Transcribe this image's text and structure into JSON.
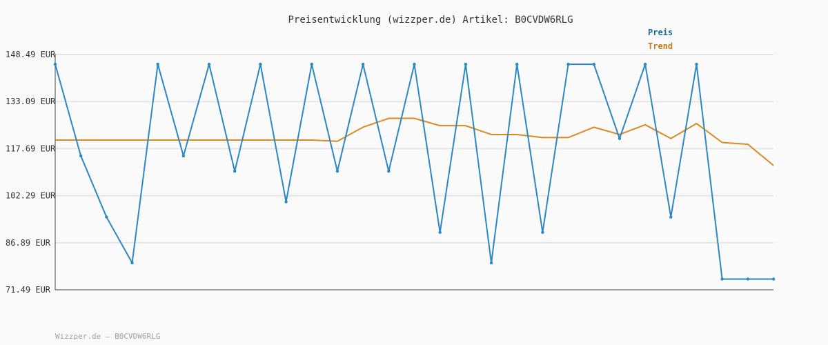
{
  "colors": {
    "background": "#fafafa",
    "grid": "#e6e6e6",
    "axis": "#444444",
    "price": "#2a87c4",
    "trend": "#d88a22",
    "legend_price": "#136f9e",
    "legend_trend": "#c57c18"
  },
  "footer_text": "Wizzper.de – B0CVDW6RLG",
  "chart_data": {
    "type": "line",
    "title": "Preisentwicklung (wizzper.de) Artikel: B0CVDW6RLG",
    "xlabel": "",
    "ylabel": "",
    "ylim": [
      71.49,
      148.49
    ],
    "yticks": [
      148.49,
      133.09,
      117.69,
      102.29,
      86.89,
      71.49
    ],
    "ytick_labels": [
      "148.49 EUR",
      "133.09 EUR",
      "117.69 EUR",
      "102.29 EUR",
      "86.89 EUR",
      "71.49 EUR"
    ],
    "grid": true,
    "legend": "top-right",
    "x": [
      1,
      2,
      3,
      4,
      5,
      6,
      7,
      8,
      9,
      10,
      11,
      12,
      13,
      14,
      15,
      16,
      17,
      18,
      19,
      20,
      21,
      22,
      23,
      24,
      25,
      26,
      27,
      28,
      29
    ],
    "series": [
      {
        "name": "Preis",
        "color": "#2a87c4",
        "markers": true,
        "values": [
          145.3,
          115.3,
          95.3,
          80.3,
          145.3,
          115.3,
          145.3,
          110.3,
          145.3,
          100.3,
          145.3,
          110.3,
          145.3,
          110.3,
          145.3,
          90.3,
          145.3,
          80.3,
          145.3,
          90.3,
          145.3,
          145.3,
          121.0,
          145.3,
          95.3,
          145.3,
          75.0,
          75.0,
          75.0
        ]
      },
      {
        "name": "Trend",
        "color": "#d88a22",
        "markers": false,
        "values": [
          120.5,
          120.5,
          120.5,
          120.5,
          120.5,
          120.5,
          120.5,
          120.5,
          120.5,
          120.5,
          120.5,
          120.1,
          124.7,
          127.6,
          127.6,
          125.2,
          125.2,
          122.3,
          122.3,
          121.3,
          121.3,
          124.7,
          122.3,
          125.5,
          121.0,
          125.9,
          119.7,
          119.1,
          112.2
        ]
      }
    ]
  }
}
